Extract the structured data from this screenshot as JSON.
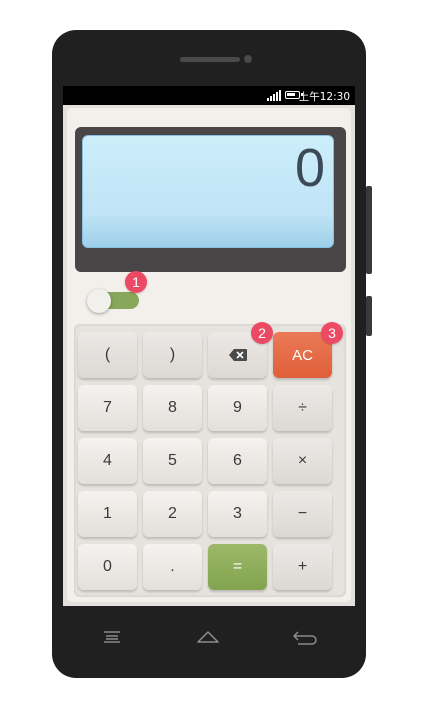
{
  "status_bar": {
    "time": "上午12:30",
    "signal_icon": "signal-bars-icon",
    "battery_icon": "battery-icon",
    "battery_level": 0.8
  },
  "display": {
    "value": "0"
  },
  "toggle": {
    "state": "on",
    "icon": "toggle-switch-icon"
  },
  "keys": {
    "open_paren": "(",
    "close_paren": ")",
    "backspace_icon": "backspace-icon",
    "ac": "AC",
    "seven": "7",
    "eight": "8",
    "nine": "9",
    "divide": "÷",
    "four": "4",
    "five": "5",
    "six": "6",
    "multiply": "×",
    "one": "1",
    "two": "2",
    "three": "3",
    "minus": "−",
    "zero": "0",
    "dot": ".",
    "equals": "=",
    "plus": "+"
  },
  "badges": [
    "1",
    "2",
    "3"
  ],
  "nav": {
    "menu_icon": "menu-icon",
    "home_icon": "home-icon",
    "back_icon": "back-icon"
  },
  "colors": {
    "ac": "#e2633e",
    "equals": "#8bab58",
    "badge": "#ec4a64",
    "display": "#c6e9f8"
  }
}
